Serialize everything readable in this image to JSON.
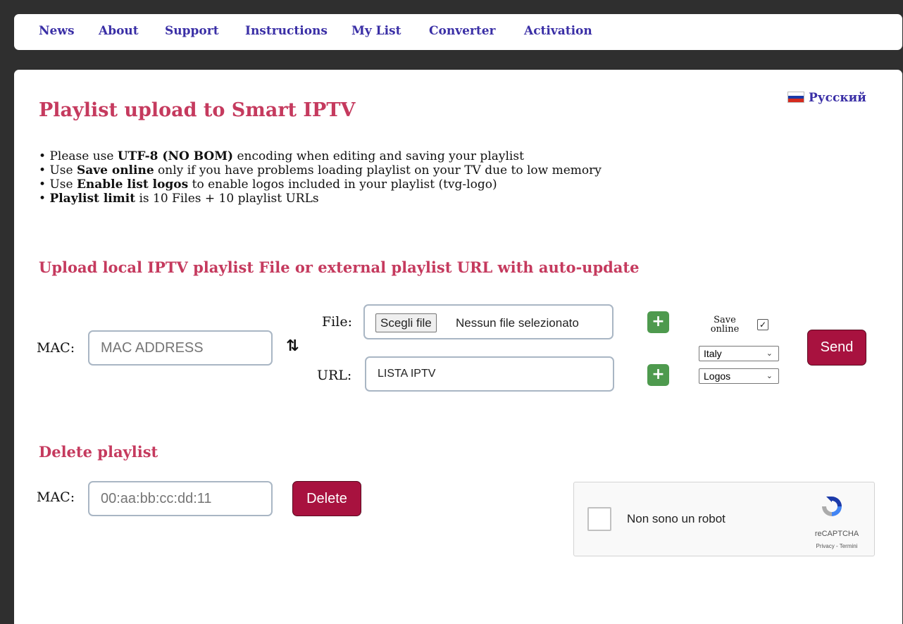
{
  "nav": {
    "items": [
      "News",
      "About",
      "Support",
      "Instructions",
      "My List",
      "Converter",
      "Activation"
    ]
  },
  "language": {
    "label": "Русский",
    "flag_colors": [
      "#ffffff",
      "#1a3aa8",
      "#d52b1e"
    ]
  },
  "page_title": "Playlist upload to Smart IPTV",
  "notes": [
    {
      "pre": "Please use ",
      "bold": "UTF-8 (NO BOM)",
      "post": " encoding when editing and saving your playlist"
    },
    {
      "pre": "Use ",
      "bold": "Save online",
      "post": " only if you have problems loading playlist on your TV due to low memory"
    },
    {
      "pre": "Use ",
      "bold": "Enable list logos",
      "post": " to enable logos included in your playlist (tvg-logo)"
    },
    {
      "pre": "",
      "bold": "Playlist limit",
      "post": " is 10 Files + 10 playlist URLs"
    }
  ],
  "upload": {
    "heading": "Upload local IPTV playlist File or external playlist URL with auto-update",
    "mac_label": "MAC:",
    "mac_placeholder": "MAC ADDRESS",
    "file_label": "File:",
    "file_button": "Scegli file",
    "file_status": "Nessun file selezionato",
    "url_label": "URL:",
    "url_value": "LISTA IPTV",
    "save_online_label": "Save online",
    "save_online_checked": "✓",
    "country_select": "Italy",
    "logos_select": "Logos",
    "send_button": "Send"
  },
  "delete": {
    "heading": "Delete playlist",
    "mac_label": "MAC:",
    "mac_placeholder": "00:aa:bb:cc:dd:11",
    "delete_button": "Delete"
  },
  "captcha": {
    "label": "Non sono un robot",
    "brand": "reCAPTCHA",
    "privacy": "Privacy",
    "separator": " - ",
    "terms": "Termini"
  },
  "colors": {
    "accent_title": "#c53a5e",
    "nav_link": "#3a2fa6",
    "button_bg": "#a8123f",
    "plus_bg": "#4e9a4e"
  }
}
